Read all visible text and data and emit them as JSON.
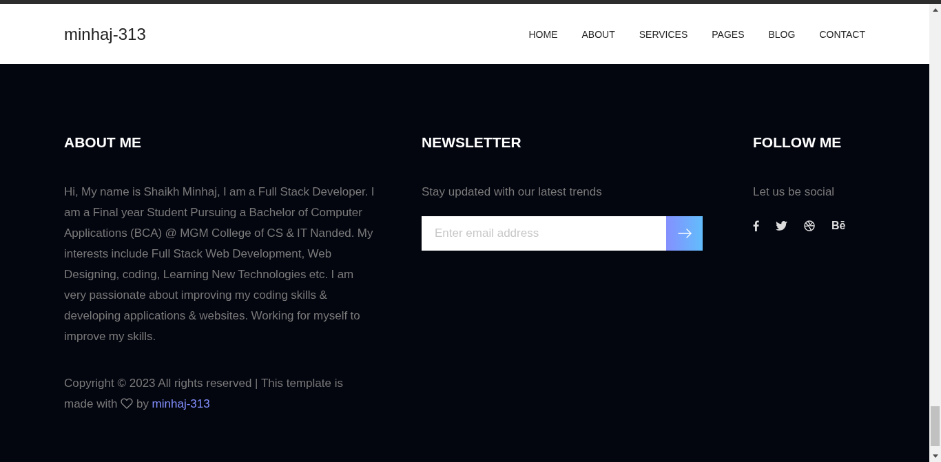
{
  "header": {
    "logo": "minhaj-313",
    "links": [
      {
        "label": "HOME"
      },
      {
        "label": "ABOUT"
      },
      {
        "label": "SERVICES"
      },
      {
        "label": "PAGES"
      },
      {
        "label": "BLOG"
      },
      {
        "label": "CONTACT"
      }
    ]
  },
  "footer": {
    "about": {
      "title": "ABOUT ME",
      "text": "Hi, My name is Shaikh Minhaj, I am a Full Stack Developer. I am a Final year Student Pursuing a Bachelor of Computer Applications (BCA) @ MGM College of CS & IT Nanded. My interests include Full Stack Web Development, Web Designing, coding, Learning New Technologies etc. I am very passionate about improving my coding skills & developing applications & websites. Working for myself to improve my skills.",
      "copyright": {
        "before": "Copyright © 2023 All rights reserved | This template is made with",
        "after": "by",
        "link": "minhaj-313"
      }
    },
    "newsletter": {
      "title": "NEWSLETTER",
      "text": "Stay updated with our latest trends",
      "placeholder": "Enter email address"
    },
    "follow": {
      "title": "FOLLOW ME",
      "text": "Let us be social",
      "socials": [
        {
          "kind": "facebook"
        },
        {
          "kind": "twitter"
        },
        {
          "kind": "dribbble"
        },
        {
          "kind": "behance",
          "glyph": "Bē"
        }
      ]
    }
  }
}
